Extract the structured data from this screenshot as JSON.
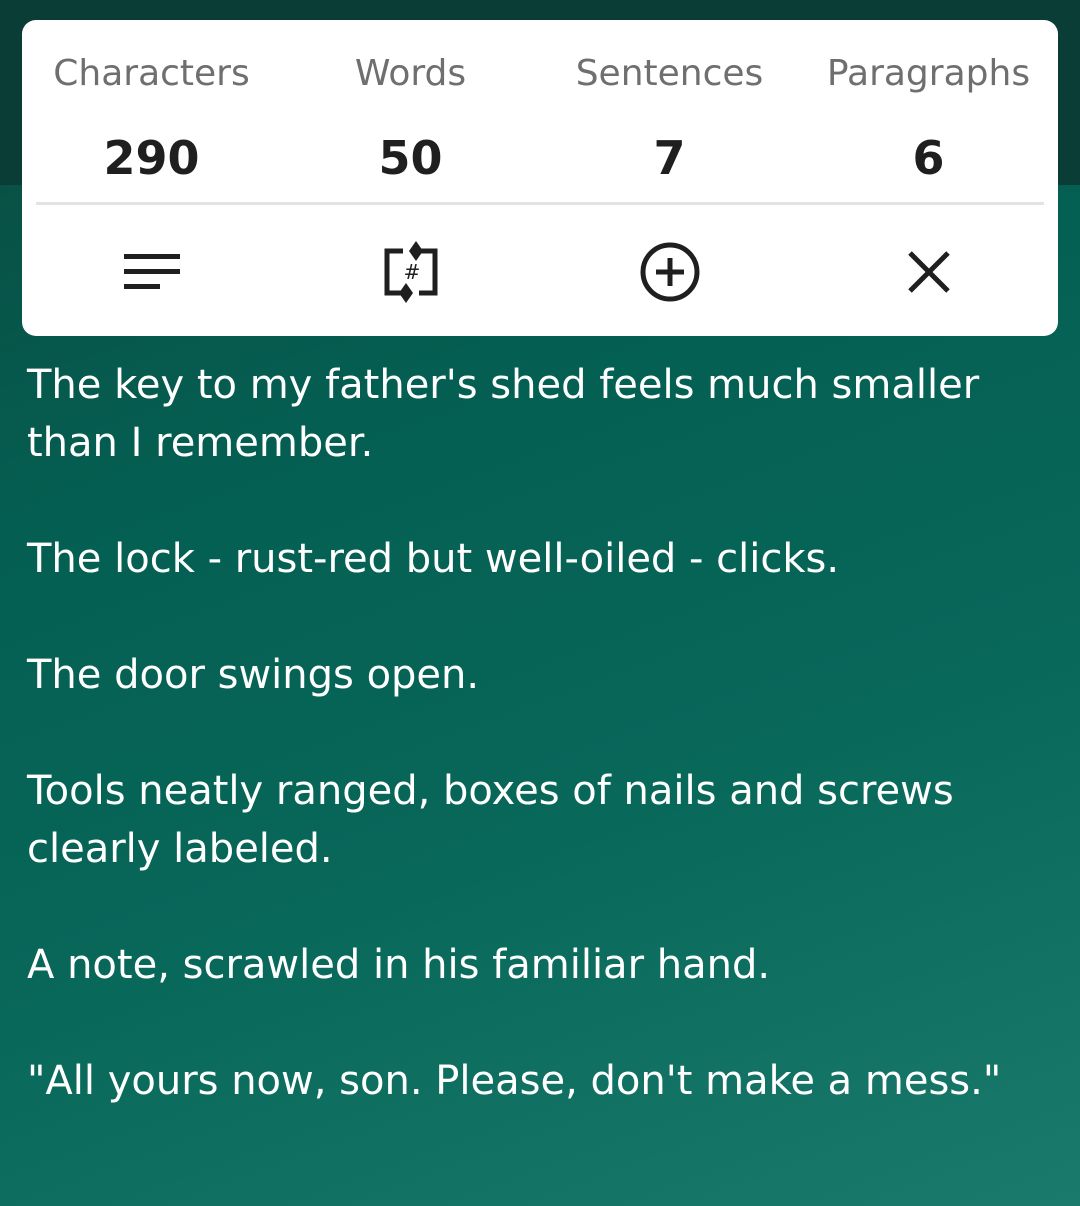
{
  "stats": {
    "labels": [
      "Characters",
      "Words",
      "Sentences",
      "Paragraphs"
    ],
    "values": [
      "290",
      "50",
      "7",
      "6"
    ]
  },
  "toolbar": {
    "icons": [
      "text-align-icon",
      "count-toggle-icon",
      "add-circle-icon",
      "close-icon"
    ]
  },
  "story": {
    "paragraphs": [
      "The key to my father's shed feels much smaller than I remember.",
      "The lock - rust-red but well-oiled - clicks.",
      "The door swings open.",
      "Tools neatly ranged, boxes of nails and screws clearly labeled.",
      "A note, scrawled in his familiar hand.",
      "\"All yours now, son. Please, don't make a mess.\""
    ]
  },
  "colors": {
    "background_top": "#0a3d35",
    "background_gradient": [
      "#0b4a40",
      "#045f52",
      "#1a7a6c"
    ],
    "card": "#ffffff",
    "label_text": "#6f6f6f",
    "value_text": "#1f1f1f",
    "icon": "#1f1f1f"
  }
}
